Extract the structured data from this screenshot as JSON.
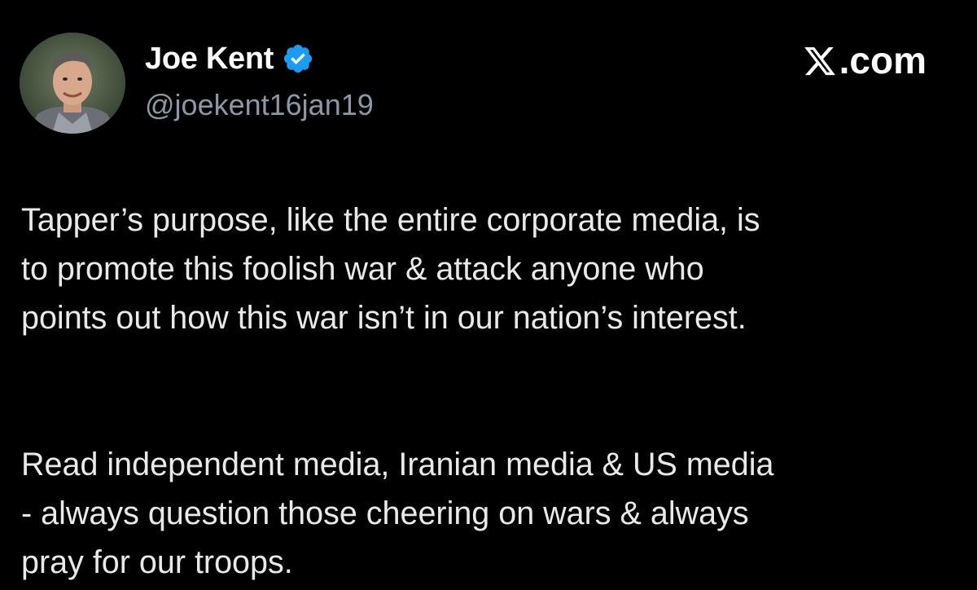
{
  "author": {
    "name": "Joe Kent",
    "handle": "@joekent16jan19",
    "verified_icon": "verified-badge-icon",
    "avatar_icon": "profile-photo"
  },
  "brand": {
    "icon": "x-logo-icon",
    "suffix": ".com"
  },
  "tweet": {
    "paragraph1_lines": [
      "Tapper’s purpose, like the entire corporate media, is",
      "to promote this foolish war & attack anyone who",
      "points out how this war isn’t in our nation’s interest."
    ],
    "paragraph2_lines": [
      "Read independent media, Iranian media & US media",
      "- always question those cheering on wars & always",
      "pray for our troops."
    ]
  },
  "colors": {
    "background": "#000000",
    "text": "#e7e9ea",
    "secondary": "#8b98a5",
    "verified": "#1d9bf0"
  }
}
